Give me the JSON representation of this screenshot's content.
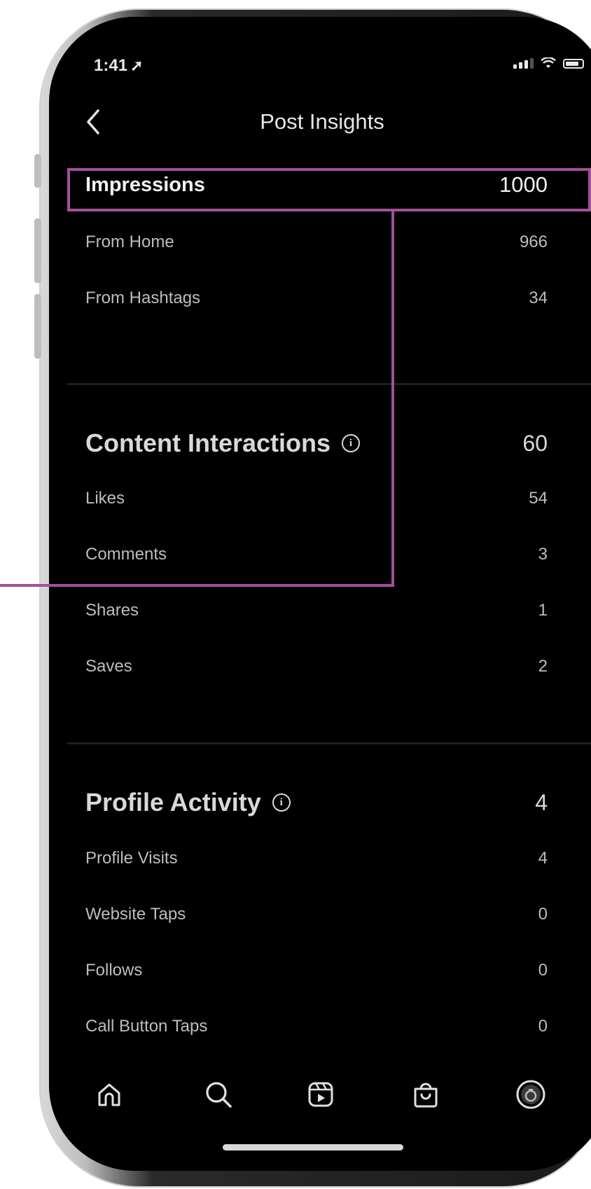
{
  "status_bar": {
    "time": "1:41",
    "location_arrow": "location-arrow-icon"
  },
  "header": {
    "title": "Post Insights",
    "back_icon": "chevron-left-icon"
  },
  "impressions": {
    "label": "Impressions",
    "value": "1000",
    "rows": [
      {
        "label": "From Home",
        "value": "966"
      },
      {
        "label": "From Hashtags",
        "value": "34"
      }
    ]
  },
  "content_interactions": {
    "label": "Content Interactions",
    "info_icon": "info-icon",
    "value": "60",
    "rows": [
      {
        "label": "Likes",
        "value": "54"
      },
      {
        "label": "Comments",
        "value": "3"
      },
      {
        "label": "Shares",
        "value": "1"
      },
      {
        "label": "Saves",
        "value": "2"
      }
    ]
  },
  "profile_activity": {
    "label": "Profile Activity",
    "info_icon": "info-icon",
    "value": "4",
    "rows": [
      {
        "label": "Profile Visits",
        "value": "4"
      },
      {
        "label": "Website Taps",
        "value": "0"
      },
      {
        "label": "Follows",
        "value": "0"
      },
      {
        "label": "Call Button Taps",
        "value": "0"
      }
    ]
  },
  "bottom_nav": [
    "home-icon",
    "search-icon",
    "reels-icon",
    "shop-icon",
    "profile-avatar-icon"
  ],
  "annotation_color": "#a2509c"
}
